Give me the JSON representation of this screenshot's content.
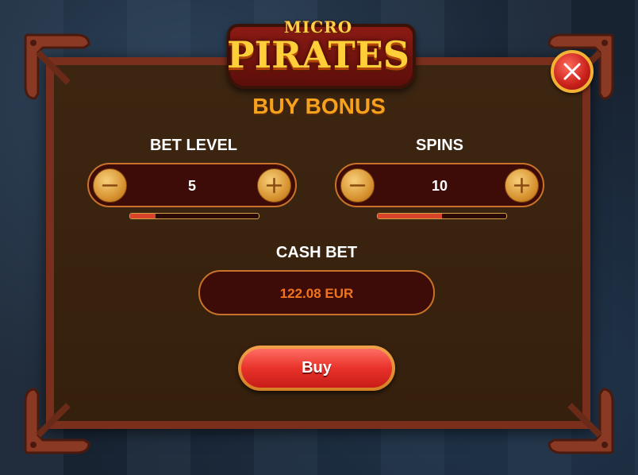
{
  "logo": {
    "line1": "MICRO",
    "line2": "PIRATES"
  },
  "dialog": {
    "title": "BUY BONUS"
  },
  "bet_level": {
    "label": "BET LEVEL",
    "value": "5",
    "level_fraction": 0.2
  },
  "spins": {
    "label": "SPINS",
    "value": "10",
    "level_fraction": 0.5
  },
  "cash_bet": {
    "label": "CASH BET",
    "value": "122.08 EUR"
  },
  "buy_button": {
    "label": "Buy"
  },
  "colors": {
    "title": "#f7a21c",
    "cash_value": "#f0741c",
    "buy_button": "#e8322a",
    "panel_border": "#7a2e1c",
    "panel_bg": "#3a2410"
  },
  "icons": {
    "close": "close-x-icon",
    "minus": "minus-icon",
    "plus": "plus-icon"
  }
}
